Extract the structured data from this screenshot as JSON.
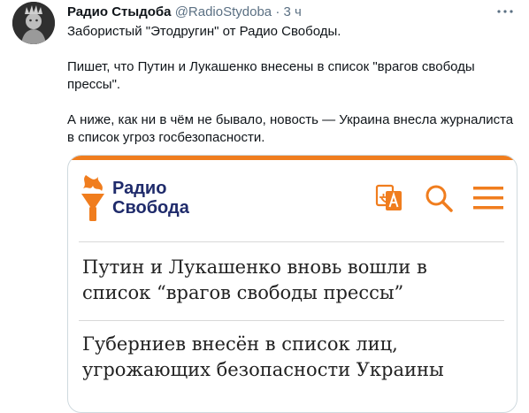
{
  "tweet": {
    "author_name": "Радио Стыдоба",
    "author_handle": "@RadioStydoba",
    "separator": "·",
    "time": "3 ч",
    "paragraphs": [
      "Забористый \"Этодругин\" от Радио Свободы.",
      "Пишет, что Путин и Лукашенко внесены в список \"врагов свободы прессы\".",
      "А ниже, как ни в чём не бывало, новость — Украина внесла журналиста в список угроз госбезопасности."
    ],
    "more_icon": "more-icon"
  },
  "card": {
    "logo_line1": "Радио",
    "logo_line2": "Свобода",
    "icons": [
      "translate-icon",
      "search-icon",
      "menu-icon"
    ],
    "headlines": [
      "Путин и Лукашенко вновь вошли в список “врагов свободы прессы”",
      "Губерниев внесён в список лиц, угрожающих безопасности Украины"
    ]
  },
  "colors": {
    "brand_orange": "#f07d1e",
    "brand_navy": "#1f2b6b",
    "text": "#0f1419",
    "muted": "#5b7083"
  }
}
